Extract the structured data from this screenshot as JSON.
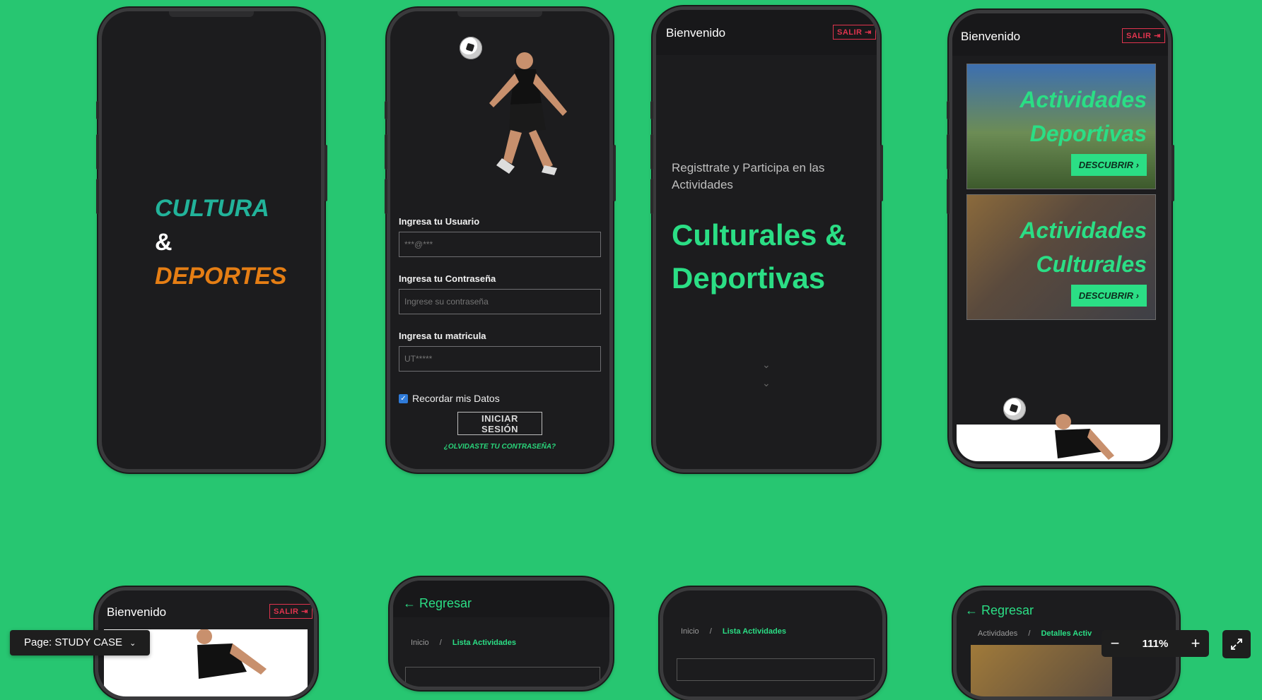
{
  "phone1": {
    "line1": "CULTURA",
    "line2": "&",
    "line3": "DEPORTES"
  },
  "phone2": {
    "user_label": "Ingresa tu Usuario",
    "user_placeholder": "***@***",
    "pass_label": "Ingresa tu Contraseña",
    "pass_placeholder": "Ingrese su contraseña",
    "matricula_label": "Ingresa tu matricula",
    "matricula_placeholder": "UT*****",
    "remember_label": "Recordar mis Datos",
    "login_button": "INICIAR SESIÓN",
    "forgot_link": "¿OLVIDASTE TU CONTRASEÑA?"
  },
  "phone3": {
    "header_title": "Bienvenido",
    "logout": "SALIR",
    "subtitle": "Registtrate y Participa en las Actividades",
    "headline_line1": "Culturales &",
    "headline_line2": "Deportivas"
  },
  "phone4": {
    "header_title": "Bienvenido",
    "logout": "SALIR",
    "card1_line1": "Actividades",
    "card1_line2": "Deportivas",
    "card2_line1": "Actividades",
    "card2_line2": "Culturales",
    "discover": "DESCUBRIR"
  },
  "phone5": {
    "header_title": "Bienvenido",
    "logout": "SALIR"
  },
  "phone6": {
    "back": "Regresar",
    "crumb_home": "Inicio",
    "crumb_sep": "/",
    "crumb_current": "Lista Actividades"
  },
  "phone7": {
    "crumb_home": "Inicio",
    "crumb_sep": "/",
    "crumb_current": "Lista Actividades"
  },
  "phone8": {
    "back": "Regresar",
    "crumb_home": "Actividades",
    "crumb_sep": "/",
    "crumb_current": "Detalles Activ"
  },
  "toolbar": {
    "page_label": "Page: STUDY CASE",
    "zoom_out": "−",
    "zoom_value": "111%",
    "zoom_in": "+"
  },
  "colors": {
    "canvas_bg": "#27c671",
    "accent_green": "#2bde85",
    "teal": "#22b39a",
    "orange": "#e57e14",
    "logout_red": "#e0344e"
  }
}
